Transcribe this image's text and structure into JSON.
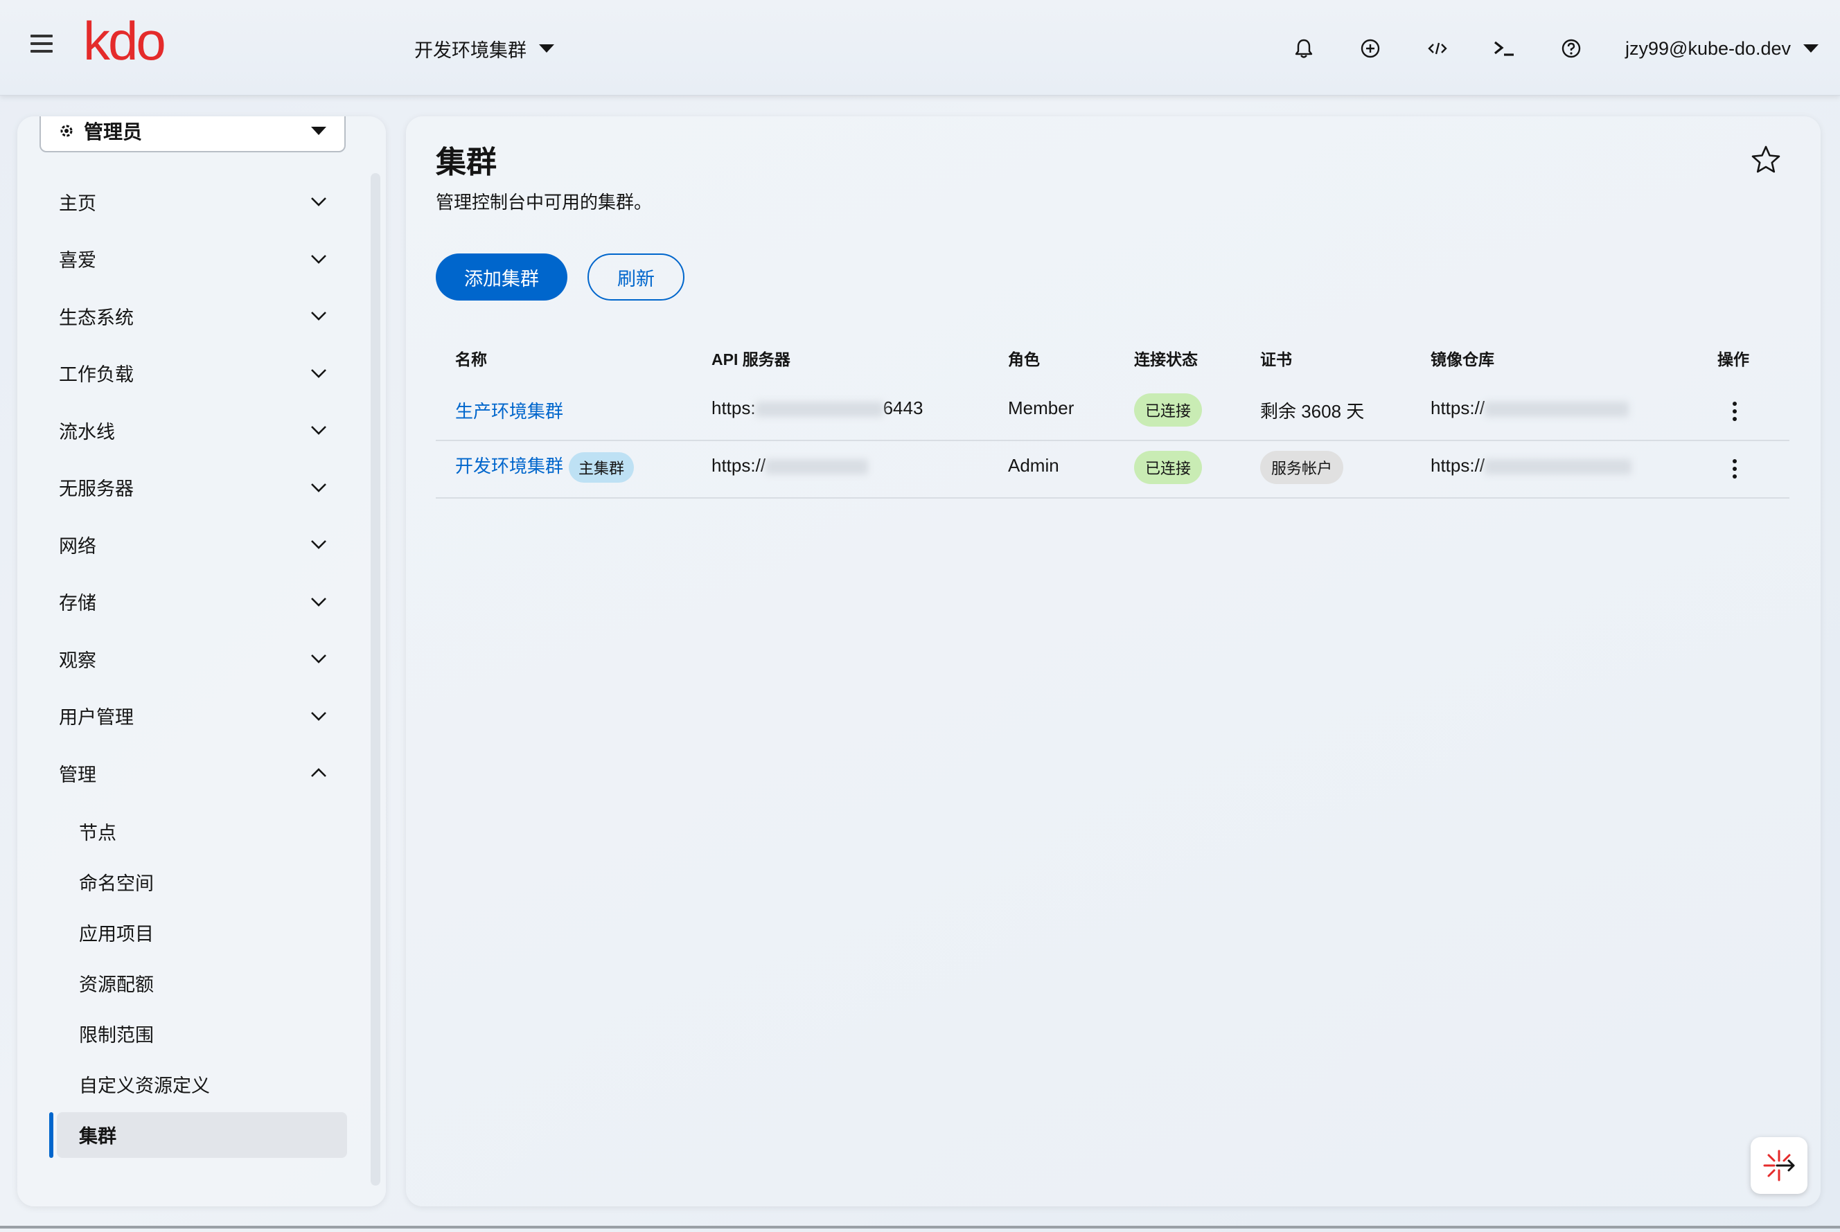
{
  "header": {
    "logo": "kdo",
    "cluster": "开发环境集群",
    "user": "jzy99@kube-do.dev"
  },
  "sidebar": {
    "perspective": "管理员",
    "items": [
      {
        "label": "主页"
      },
      {
        "label": "喜爱"
      },
      {
        "label": "生态系统"
      },
      {
        "label": "工作负载"
      },
      {
        "label": "流水线"
      },
      {
        "label": "无服务器"
      },
      {
        "label": "网络"
      },
      {
        "label": "存储"
      },
      {
        "label": "观察"
      },
      {
        "label": "用户管理"
      },
      {
        "label": "管理"
      }
    ],
    "sub_items": [
      {
        "label": "节点"
      },
      {
        "label": "命名空间"
      },
      {
        "label": "应用项目"
      },
      {
        "label": "资源配额"
      },
      {
        "label": "限制范围"
      },
      {
        "label": "自定义资源定义"
      },
      {
        "label": "集群"
      }
    ]
  },
  "main": {
    "title": "集群",
    "description": "管理控制台中可用的集群。",
    "add_button": "添加集群",
    "refresh_button": "刷新",
    "columns": [
      "名称",
      "API 服务器",
      "角色",
      "连接状态",
      "证书",
      "镜像仓库",
      "操作"
    ],
    "rows": [
      {
        "name": "生产环境集群",
        "badge": "",
        "api_prefix": "https:",
        "api_suffix": "6443",
        "role": "Member",
        "status": "已连接",
        "cert": "剩余 3608 天",
        "registry_prefix": "https://"
      },
      {
        "name": "开发环境集群",
        "badge": "主集群",
        "api_prefix": "https://",
        "api_suffix": "",
        "role": "Admin",
        "status": "已连接",
        "cert": "服务帐户",
        "registry_prefix": "https://"
      }
    ]
  }
}
